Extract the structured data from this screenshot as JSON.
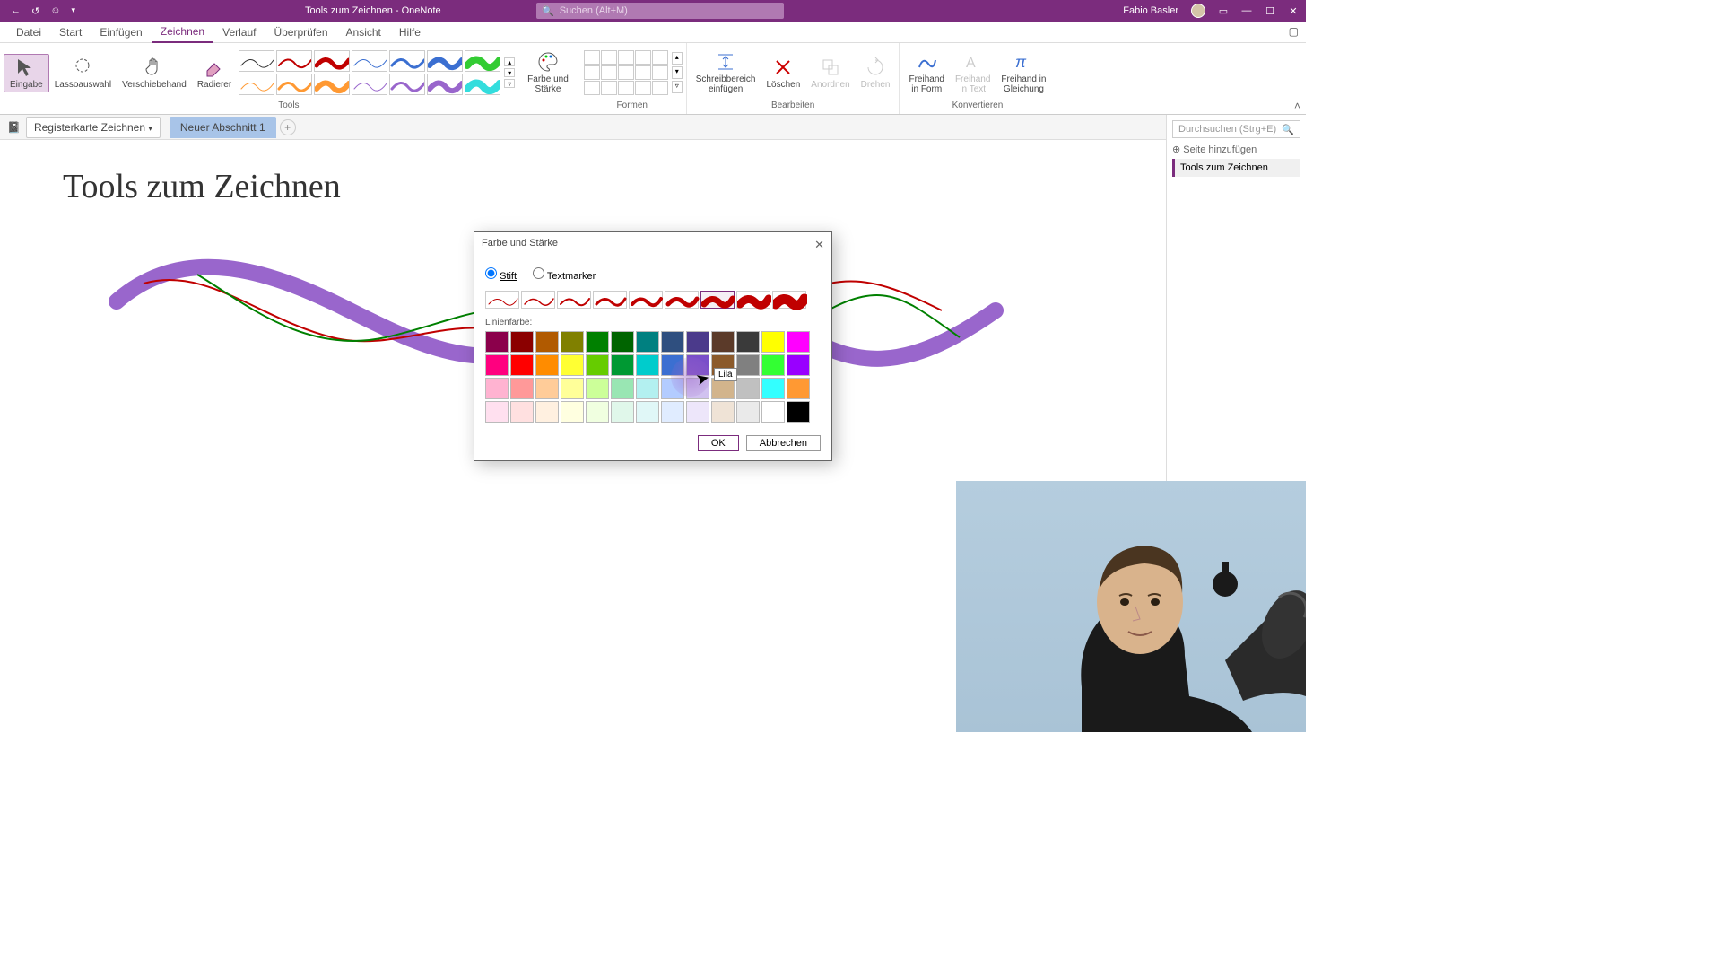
{
  "titlebar": {
    "doc_title": "Tools zum Zeichnen",
    "app_name": "OneNote",
    "search_placeholder": "Suchen (Alt+M)",
    "user_name": "Fabio Basler"
  },
  "menu": {
    "tabs": [
      "Datei",
      "Start",
      "Einfügen",
      "Zeichnen",
      "Verlauf",
      "Überprüfen",
      "Ansicht",
      "Hilfe"
    ],
    "active": "Zeichnen"
  },
  "ribbon": {
    "group_tools": "Tools",
    "group_shapes": "Formen",
    "group_edit": "Bearbeiten",
    "group_convert": "Konvertieren",
    "eingabe": "Eingabe",
    "lasso": "Lassoauswahl",
    "hand": "Verschiebehand",
    "eraser": "Radierer",
    "color_thickness": "Farbe und\nStärke",
    "insert_write": "Schreibbereich\neinfügen",
    "delete": "Löschen",
    "arrange": "Anordnen",
    "rotate": "Drehen",
    "ink_shape": "Freihand\nin Form",
    "ink_text": "Freihand\nin Text",
    "ink_eq": "Freihand in\nGleichung"
  },
  "notebook": {
    "name": "Registerkarte Zeichnen",
    "section": "Neuer Abschnitt 1"
  },
  "rightpanel": {
    "search_placeholder": "Durchsuchen (Strg+E)",
    "add_page": "Seite hinzufügen",
    "page_selected": "Tools zum Zeichnen"
  },
  "page": {
    "title": "Tools zum Zeichnen"
  },
  "dialog": {
    "title": "Farbe und Stärke",
    "pen": "Stift",
    "marker": "Textmarker",
    "linecolor": "Linienfarbe:",
    "ok": "OK",
    "cancel": "Abbrechen",
    "tooltip": "Lila",
    "thicknesses_px": [
      1,
      1.5,
      2,
      3,
      4,
      5,
      7,
      9,
      11
    ],
    "selected_thickness_index": 6,
    "colors": [
      [
        "#8b004b",
        "#8b0000",
        "#b15a00",
        "#808000",
        "#008000",
        "#006400",
        "#008080",
        "#2f4f7f",
        "#4b3a8b",
        "#5b3a29",
        "#3a3a3a",
        "#ffff00",
        "#ff00ff"
      ],
      [
        "#ff007f",
        "#ff0000",
        "#ff8c00",
        "#ffff33",
        "#66cc00",
        "#009933",
        "#00cccc",
        "#3b6fd1",
        "#7a4fc9",
        "#8b5a2b",
        "#808080",
        "#33ff33",
        "#9900ff"
      ],
      [
        "#ffb3d1",
        "#ff9999",
        "#ffcc99",
        "#ffff99",
        "#ccff99",
        "#99e6b3",
        "#b3f0f0",
        "#b3ccff",
        "#d1c2f0",
        "#d2b48c",
        "#c0c0c0",
        "#33ffff",
        "#ff9933"
      ],
      [
        "#ffe0ef",
        "#ffe0e0",
        "#fff0e0",
        "#ffffe0",
        "#f0ffe0",
        "#e0f7ea",
        "#e0f7f7",
        "#e0ecff",
        "#ede6fa",
        "#efe3d6",
        "#eaeaea",
        "#ffffff",
        "#000000"
      ]
    ]
  },
  "pen_colors_top": [
    "#333333",
    "#c00000",
    "#c00000",
    "#3b6fd1",
    "#3b6fd1",
    "#3b6fd1",
    "#33cc33"
  ],
  "pen_colors_bot": [
    "#ff9933",
    "#ff9933",
    "#ff9933",
    "#9966cc",
    "#9966cc",
    "#9966cc",
    "#33dddd"
  ],
  "pen_widths_top": [
    1,
    2,
    5,
    1,
    3,
    6,
    8
  ],
  "pen_widths_bot": [
    1,
    3,
    6,
    1,
    3,
    6,
    8
  ],
  "chart_data": null
}
